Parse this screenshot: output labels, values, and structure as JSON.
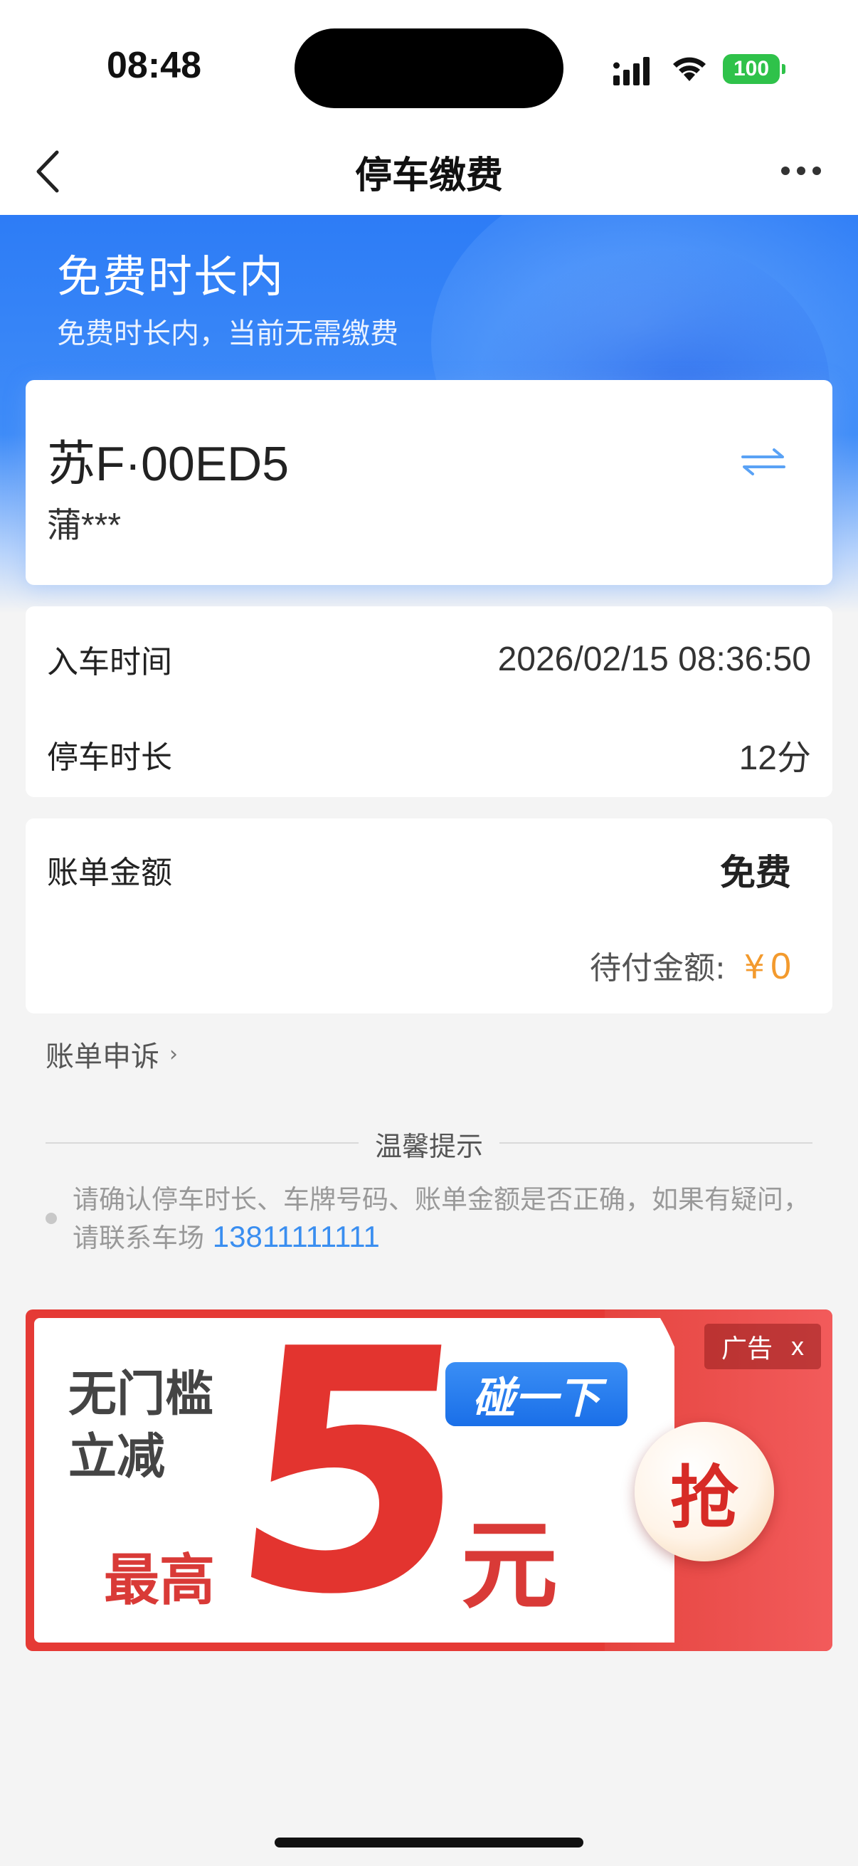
{
  "status_bar": {
    "time": "08:48",
    "battery": "100"
  },
  "nav": {
    "title": "停车缴费"
  },
  "banner": {
    "title": "免费时长内",
    "subtitle": "免费时长内，当前无需缴费"
  },
  "plate": {
    "number": "苏F·00ED5",
    "owner": "蒲***"
  },
  "info": {
    "entry_label": "入车时间",
    "entry_value": "2026/02/15 08:36:50",
    "duration_label": "停车时长",
    "duration_value": "12分"
  },
  "bill": {
    "label": "账单金额",
    "amount": "免费",
    "due_label": "待付金额:",
    "due_currency": "¥",
    "due_value": "0"
  },
  "appeal": {
    "label": "账单申诉",
    "chevron": "›"
  },
  "tips": {
    "title": "温馨提示",
    "text": "请确认停车时长、车牌号码、账单金额是否正确，如果有疑问，请联系车场",
    "phone": "13811111111"
  },
  "ad": {
    "line1": "无门槛",
    "line2": "立减",
    "max": "最高",
    "amount": "5",
    "unit": "元",
    "tap": "碰一下",
    "grab": "抢",
    "badge": "广告",
    "close": "x"
  },
  "colors": {
    "accent_blue": "#2d7cf6",
    "price_orange": "#f39a2d",
    "link_blue": "#3a8ef0",
    "ad_red": "#e3342f"
  }
}
